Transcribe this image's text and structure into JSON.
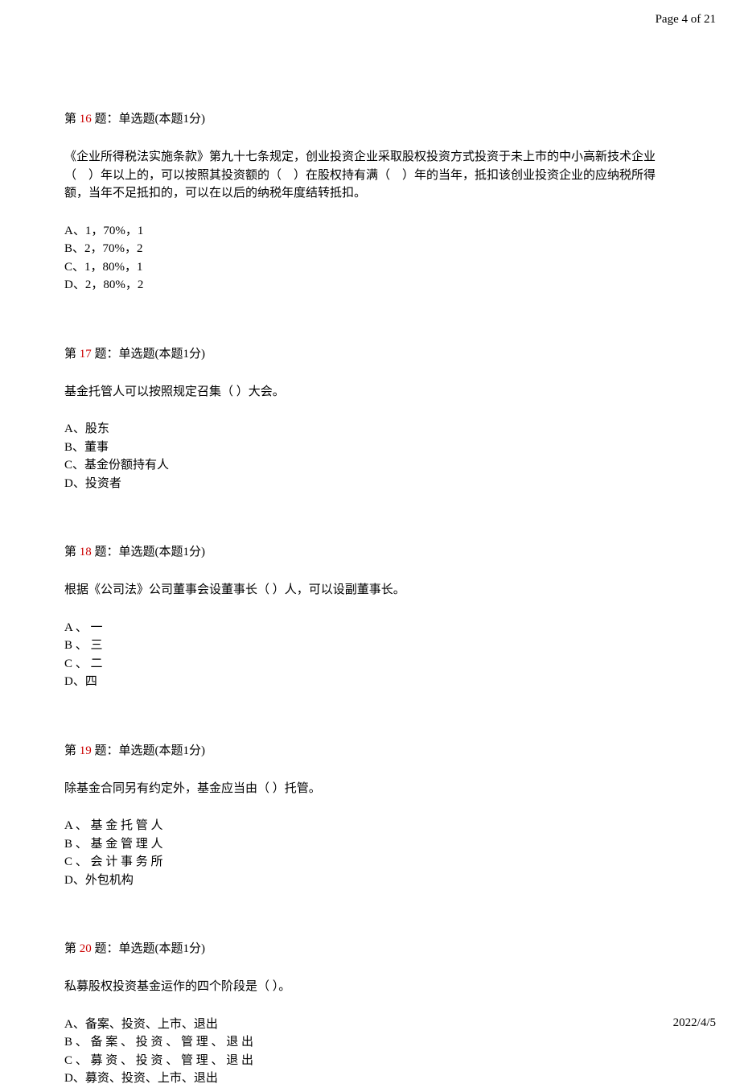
{
  "header": {
    "page_info": "Page 4 of 21"
  },
  "footer": {
    "date": "2022/4/5"
  },
  "questions": [
    {
      "prefix": "第  ",
      "num": "16",
      "suffix": " 题：单选题(本题1分)",
      "text": "《企业所得税法实施条款》第九十七条规定，创业投资企业采取股权投资方式投资于未上市的中小高新技术企业（　）年以上的，可以按照其投资额的（　）在股权持有满（　）年的当年，抵扣该创业投资企业的应纳税所得额，当年不足抵扣的，可以在以后的纳税年度结转抵扣。",
      "options": [
        "A、1，70%，1",
        "B、2，70%，2",
        "C、1，80%，1",
        "D、2，80%，2"
      ]
    },
    {
      "prefix": "第  ",
      "num": "17",
      "suffix": " 题：单选题(本题1分)",
      "text": "基金托管人可以按照规定召集（  ）大会。",
      "options": [
        "A、股东",
        "B、董事",
        "C、基金份额持有人",
        "D、投资者"
      ]
    },
    {
      "prefix": "第  ",
      "num": "18",
      "suffix": " 题：单选题(本题1分)",
      "text": "根据《公司法》公司董事会设董事长（  ）人，可以设副董事长。",
      "options": [
        "A 、 一",
        "B 、 三",
        "C 、 二",
        "D、四"
      ]
    },
    {
      "prefix": "第  ",
      "num": "19",
      "suffix": " 题：单选题(本题1分)",
      "text": "除基金合同另有约定外，基金应当由（  ）托管。",
      "options": [
        "A 、 基 金 托 管 人",
        "B 、 基 金 管 理 人",
        "C 、 会 计 事 务 所",
        "D、外包机构"
      ]
    },
    {
      "prefix": "第  ",
      "num": "20",
      "suffix": " 题：单选题(本题1分)",
      "text": "私募股权投资基金运作的四个阶段是（  ）。",
      "options": [
        "A、备案、投资、上市、退出",
        "B 、 备 案 、 投 资 、 管 理 、 退 出",
        "C 、 募 资 、 投 资 、 管 理 、 退 出",
        "D、募资、投资、上市、退出"
      ]
    }
  ]
}
